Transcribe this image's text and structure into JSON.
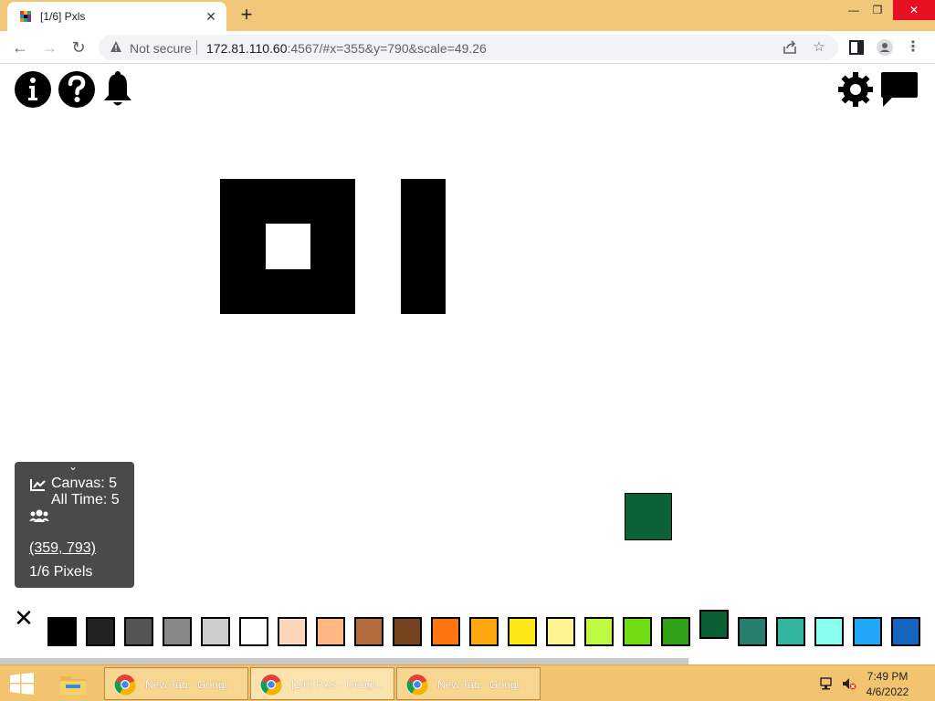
{
  "browser": {
    "tab_title": "[1/6] Pxls",
    "tab_close_glyph": "✕",
    "new_tab_glyph": "+",
    "window_controls": [
      "—",
      "❐",
      "✕"
    ],
    "back_glyph": "←",
    "forward_glyph": "→",
    "reload_glyph": "↻",
    "not_secure_label": "Not secure",
    "url_host": "172.81.110.60",
    "url_rest": ":4567/#x=355&y=790&scale=49.26",
    "share_icon": "share-icon",
    "bookmark_glyph": "☆",
    "sidepanel_icon": "side-panel-icon",
    "profile_icon": "profile-icon",
    "menu_glyph": "⋮"
  },
  "page": {
    "top_left_icons": [
      "info-icon",
      "help-icon",
      "bell-icon"
    ],
    "top_right_icons": [
      "settings-gear-icon",
      "chat-icon"
    ],
    "info_panel": {
      "chevron_glyph": "⌄",
      "canvas_label": "Canvas: 5",
      "alltime_label": "All Time: 5",
      "coords_link": "(359, 793)",
      "pixels_label": "1/6 Pixels"
    },
    "selected_color": "#0b6138",
    "palette_close_glyph": "✕",
    "palette": [
      "#000000",
      "#222222",
      "#555555",
      "#888888",
      "#cdcdcd",
      "#ffffff",
      "#ffd5bc",
      "#ffb783",
      "#b66d3d",
      "#77431f",
      "#fc7510",
      "#fca80e",
      "#fde817",
      "#fff491",
      "#bef840",
      "#70dd13",
      "#31a117",
      "#0b5f35",
      "#277e6c",
      "#32b69f",
      "#88ffef",
      "#21a7f7",
      "#1565c0"
    ],
    "active_swatch_index": 17
  },
  "taskbar": {
    "apps": [
      {
        "label": "New Tab - Googl...",
        "active": false
      },
      {
        "label": "[1/6] Pxls - Googl...",
        "active": true
      },
      {
        "label": "New Tab - Googl...",
        "active": false
      }
    ],
    "clock_time": "7:49 PM",
    "clock_date": "4/6/2022"
  }
}
